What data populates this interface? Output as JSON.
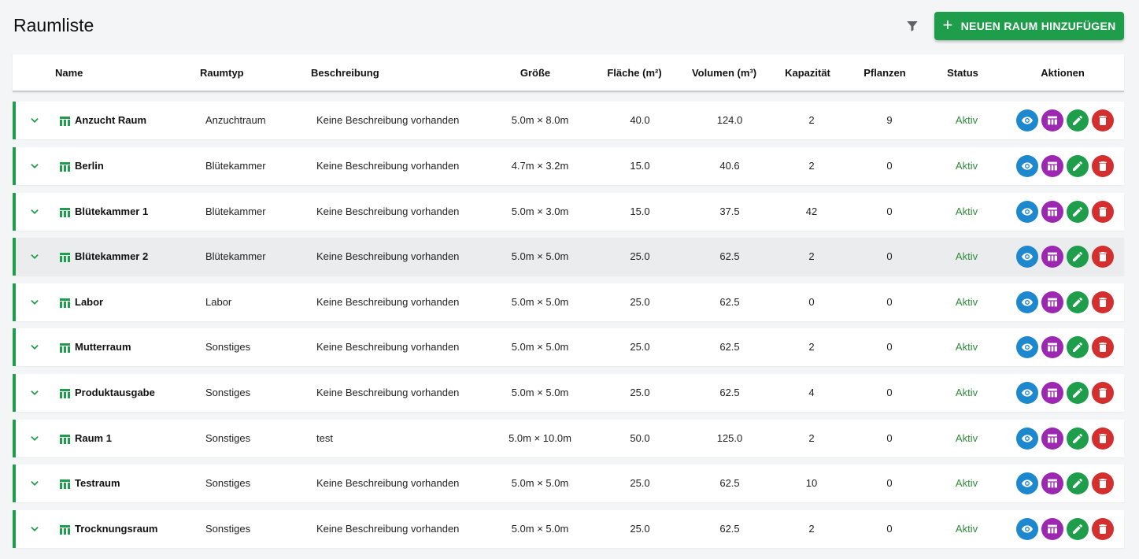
{
  "page": {
    "title": "Raumliste",
    "add_button_label": "NEUEN RAUM HINZUFÜGEN",
    "filter_icon": "filter-icon"
  },
  "columns": {
    "name": "Name",
    "type": "Raumtyp",
    "description": "Beschreibung",
    "size": "Größe",
    "area": "Fläche (m²)",
    "volume": "Volumen (m³)",
    "capacity": "Kapazität",
    "plants": "Pflanzen",
    "status": "Status",
    "actions": "Aktionen"
  },
  "colors": {
    "accent": "#1e9e4a",
    "view": "#1e88cf",
    "layout": "#9c27b0",
    "edit": "#1e9e4a",
    "delete": "#d32f2f",
    "status_active": "#2e8b3c"
  },
  "rows": [
    {
      "name": "Anzucht Raum",
      "type": "Anzuchtraum",
      "description": "Keine Beschreibung vorhanden",
      "size": "5.0m × 8.0m",
      "area": "40.0",
      "volume": "124.0",
      "capacity": "2",
      "plants": "9",
      "status": "Aktiv"
    },
    {
      "name": "Berlin",
      "type": "Blütekammer",
      "description": "Keine Beschreibung vorhanden",
      "size": "4.7m × 3.2m",
      "area": "15.0",
      "volume": "40.6",
      "capacity": "2",
      "plants": "0",
      "status": "Aktiv"
    },
    {
      "name": "Blütekammer 1",
      "type": "Blütekammer",
      "description": "Keine Beschreibung vorhanden",
      "size": "5.0m × 3.0m",
      "area": "15.0",
      "volume": "37.5",
      "capacity": "42",
      "plants": "0",
      "status": "Aktiv"
    },
    {
      "name": "Blütekammer 2",
      "type": "Blütekammer",
      "description": "Keine Beschreibung vorhanden",
      "size": "5.0m × 5.0m",
      "area": "25.0",
      "volume": "62.5",
      "capacity": "2",
      "plants": "0",
      "status": "Aktiv"
    },
    {
      "name": "Labor",
      "type": "Labor",
      "description": "Keine Beschreibung vorhanden",
      "size": "5.0m × 5.0m",
      "area": "25.0",
      "volume": "62.5",
      "capacity": "0",
      "plants": "0",
      "status": "Aktiv"
    },
    {
      "name": "Mutterraum",
      "type": "Sonstiges",
      "description": "Keine Beschreibung vorhanden",
      "size": "5.0m × 5.0m",
      "area": "25.0",
      "volume": "62.5",
      "capacity": "2",
      "plants": "0",
      "status": "Aktiv"
    },
    {
      "name": "Produktausgabe",
      "type": "Sonstiges",
      "description": "Keine Beschreibung vorhanden",
      "size": "5.0m × 5.0m",
      "area": "25.0",
      "volume": "62.5",
      "capacity": "4",
      "plants": "0",
      "status": "Aktiv"
    },
    {
      "name": "Raum 1",
      "type": "Sonstiges",
      "description": "test",
      "size": "5.0m × 10.0m",
      "area": "50.0",
      "volume": "125.0",
      "capacity": "2",
      "plants": "0",
      "status": "Aktiv"
    },
    {
      "name": "Testraum",
      "type": "Sonstiges",
      "description": "Keine Beschreibung vorhanden",
      "size": "5.0m × 5.0m",
      "area": "25.0",
      "volume": "62.5",
      "capacity": "10",
      "plants": "0",
      "status": "Aktiv"
    },
    {
      "name": "Trocknungsraum",
      "type": "Sonstiges",
      "description": "Keine Beschreibung vorhanden",
      "size": "5.0m × 5.0m",
      "area": "25.0",
      "volume": "62.5",
      "capacity": "2",
      "plants": "0",
      "status": "Aktiv"
    }
  ],
  "hovered_row_index": 3
}
